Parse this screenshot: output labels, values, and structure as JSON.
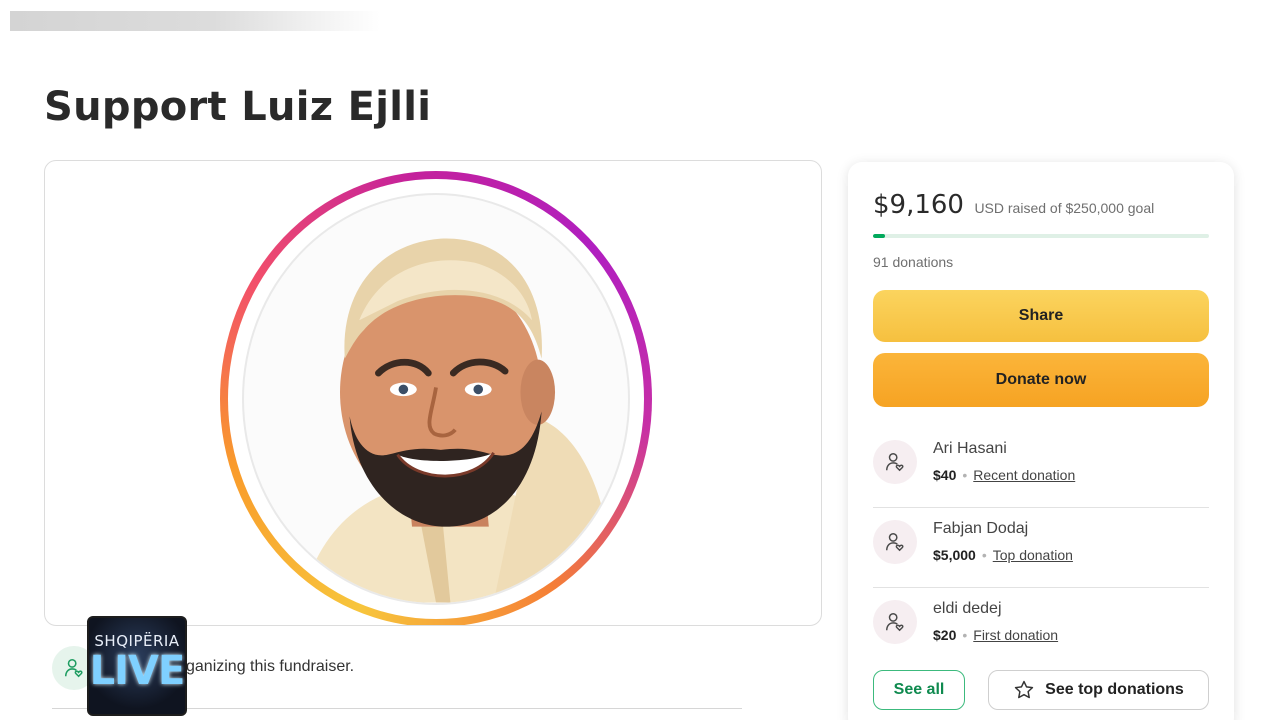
{
  "page": {
    "title": "Support Luiz Ejlli"
  },
  "organizer": {
    "text": "ganizing this fundraiser."
  },
  "watermark": {
    "top": "SHQIPËRIA",
    "main": "LIVE"
  },
  "donation_panel": {
    "raised_amount": "$9,160",
    "raised_goal_text": "USD raised of $250,000 goal",
    "progress_fraction": 0.037,
    "donation_count": "91 donations",
    "share_label": "Share",
    "donate_label": "Donate now",
    "donors": [
      {
        "name": "Ari Hasani",
        "amount": "$40",
        "label": "Recent donation"
      },
      {
        "name": "Fabjan Dodaj",
        "amount": "$5,000",
        "label": "Top donation"
      },
      {
        "name": "eldi dedej",
        "amount": "$20",
        "label": "First donation"
      }
    ],
    "see_all_label": "See all",
    "see_top_label": "See top donations"
  },
  "colors": {
    "accent_green": "#02a95c",
    "share_yellow": "#f6c03f",
    "donate_orange": "#f6a323"
  },
  "icons": {
    "donor_avatar": "person-heart-icon",
    "organizer_avatar": "person-heart-icon",
    "see_top": "star-outline-icon"
  }
}
